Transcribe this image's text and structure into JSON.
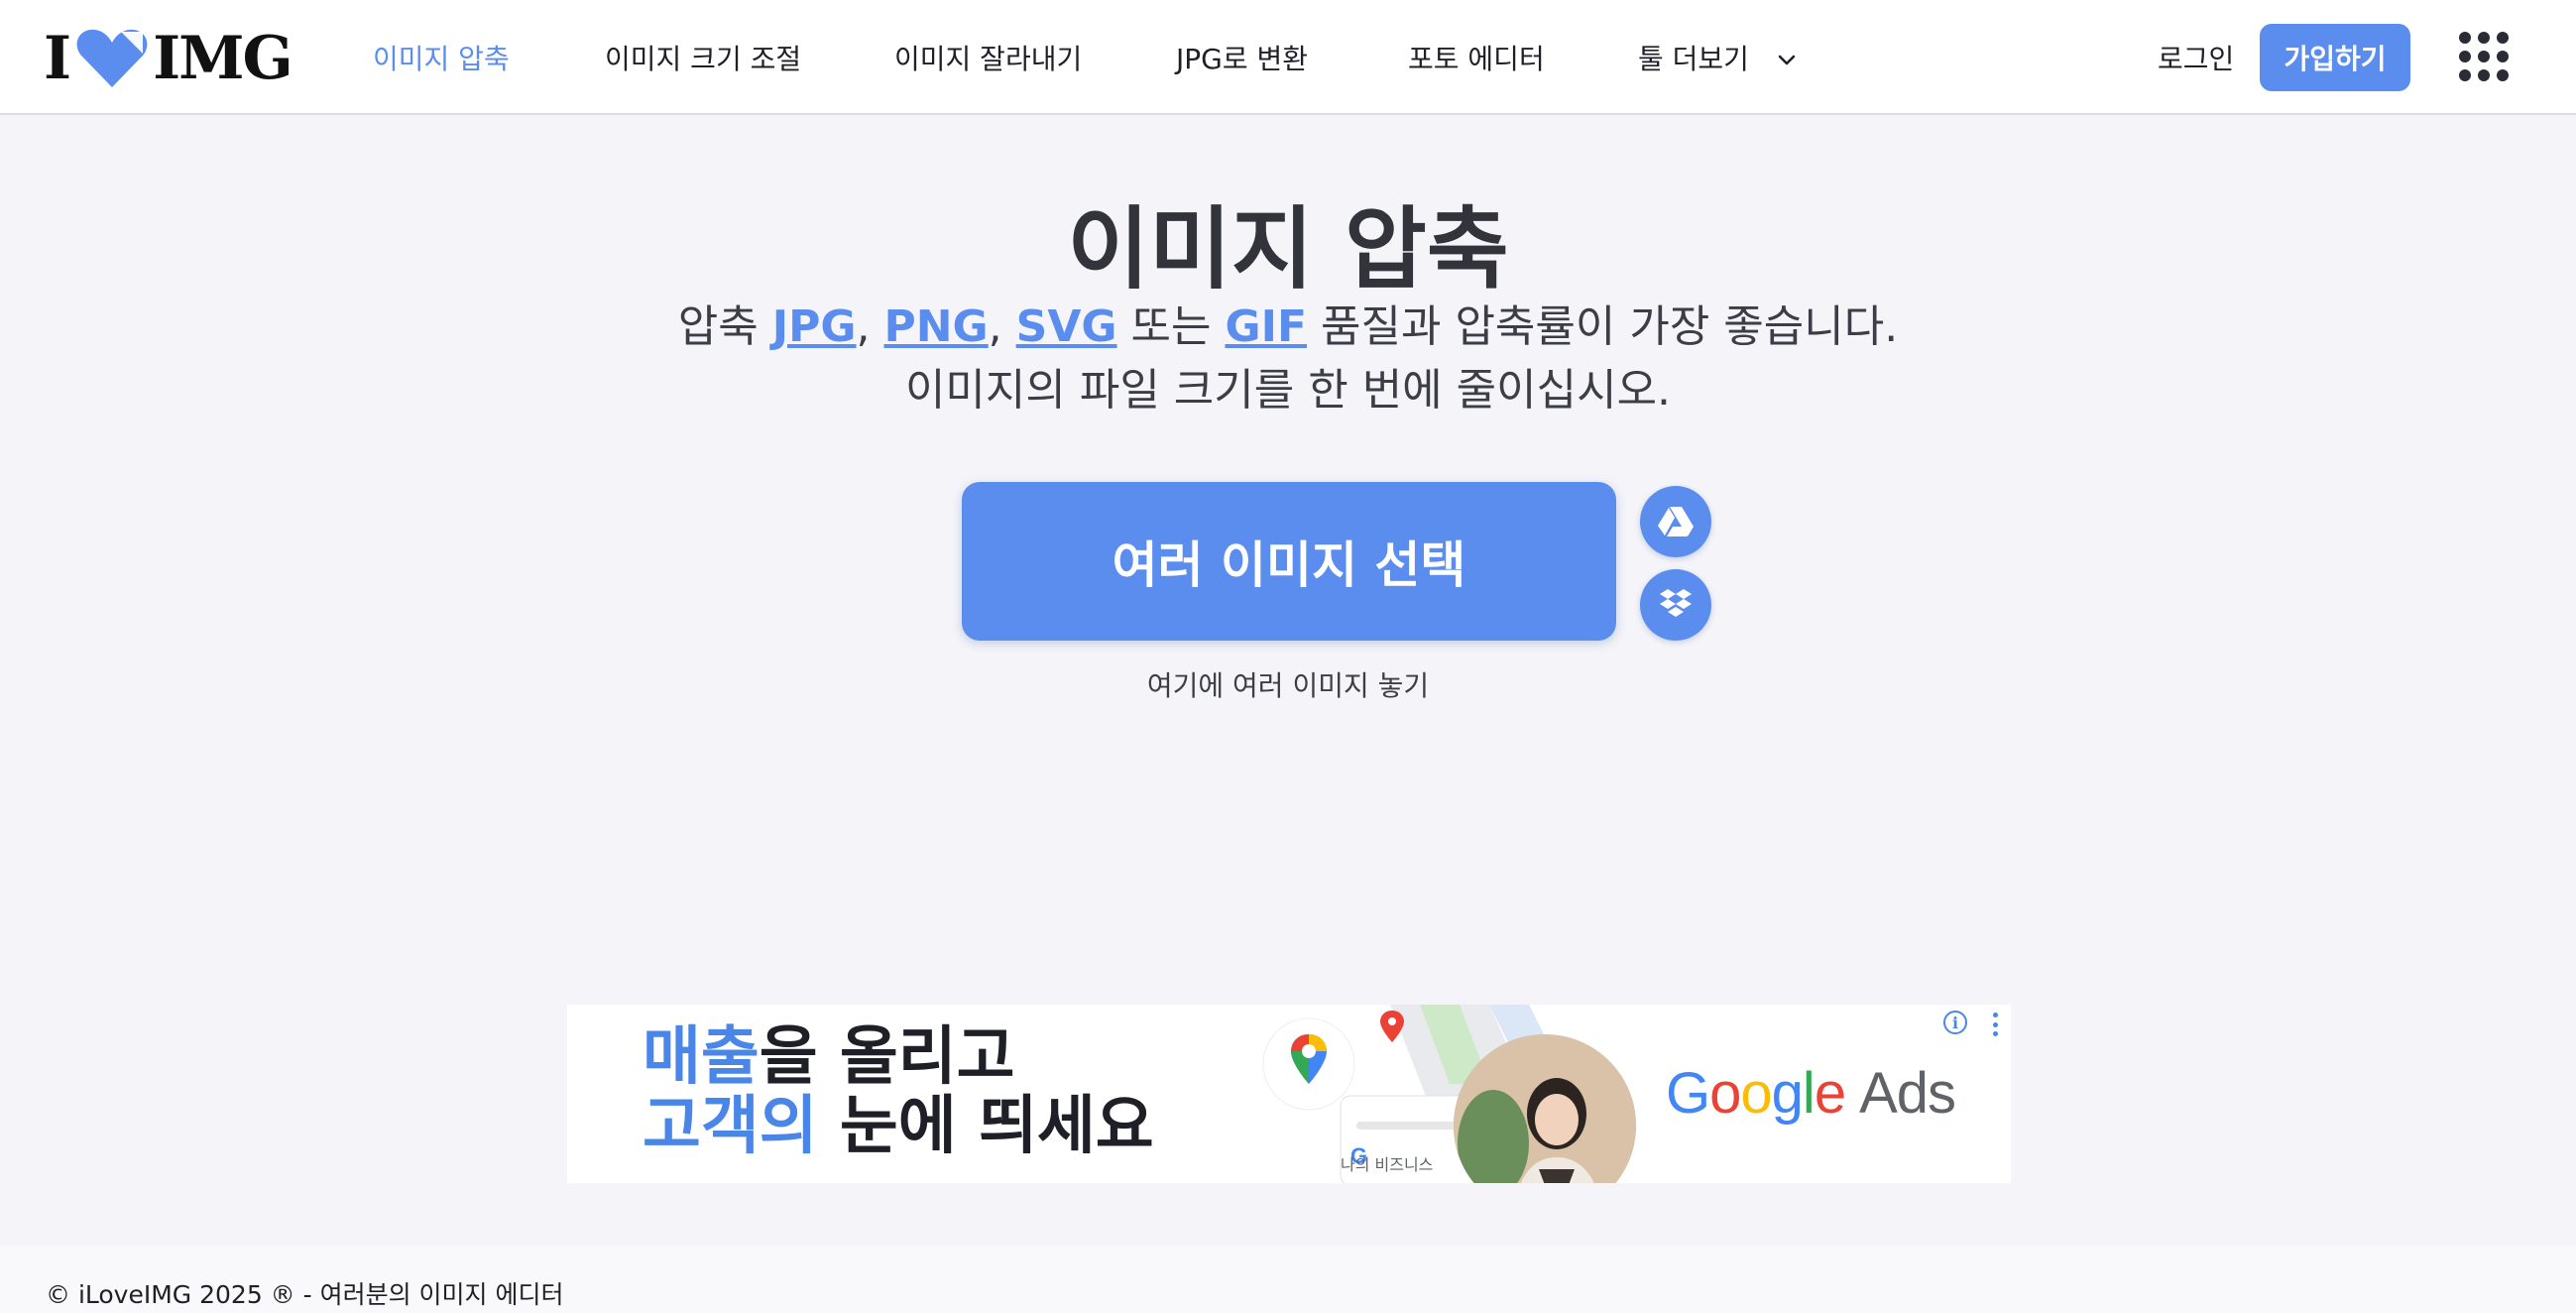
{
  "header": {
    "logo": {
      "left": "I",
      "right": "IMG"
    },
    "nav": [
      {
        "label": "이미지 압축",
        "active": true
      },
      {
        "label": "이미지 크기 조절",
        "active": false
      },
      {
        "label": "이미지 잘라내기",
        "active": false
      },
      {
        "label": "JPG로 변환",
        "active": false
      },
      {
        "label": "포토 에디터",
        "active": false
      },
      {
        "label": "툴 더보기",
        "active": false
      }
    ],
    "login_label": "로그인",
    "signup_label": "가입하기"
  },
  "hero": {
    "title": "이미지 압축",
    "subtitle": {
      "prefix": "압축",
      "formats": [
        "JPG",
        "PNG",
        "SVG",
        "GIF"
      ],
      "sep": ",",
      "or": "또는",
      "suffix": "품질과 압축률이 가장 좋습니다.",
      "line2": "이미지의 파일 크기를 한 번에 줄이십시오."
    },
    "select_button": "여러 이미지 선택",
    "drop_hint": "여기에 여러 이미지 놓기"
  },
  "ad": {
    "line1_highlight": "매출",
    "line1_rest": "을 올리고",
    "line2_highlight": "고객의",
    "line2_rest": " 눈에 띄세요",
    "biz_label": "나의 비즈니스",
    "brand_letters": [
      "G",
      "o",
      "o",
      "g",
      "l",
      "e"
    ],
    "brand_ads": "Ads",
    "info_glyph": "i"
  },
  "footer": {
    "text": "© iLoveIMG 2025 ® - 여러분의 이미지 에디터"
  },
  "colors": {
    "accent": "#5b8def",
    "background": "#f4f4f9",
    "text": "#1f1f27"
  }
}
